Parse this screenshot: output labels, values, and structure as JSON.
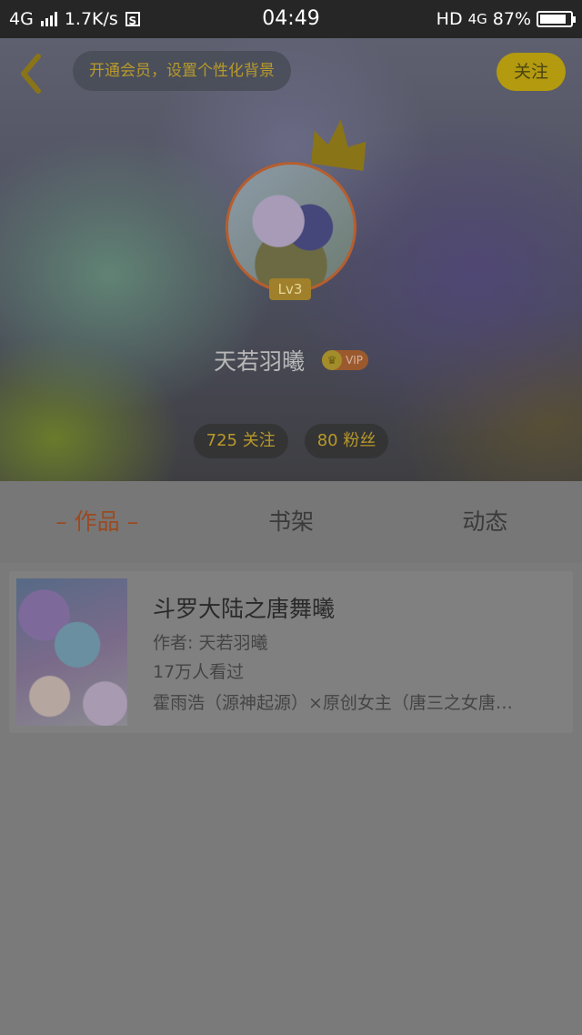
{
  "status_bar": {
    "network": "4G",
    "speed": "1.7K/s",
    "s_icon": "S",
    "time": "04:49",
    "hd": "HD",
    "network_right": "4G",
    "battery": "87%",
    "battery_level": 0.87
  },
  "header": {
    "promo": "开通会员，设置个性化背景",
    "follow": "关注",
    "level": "Lv3",
    "nickname": "天若羽曦",
    "vip": "VIP",
    "following": "725 关注",
    "fans": "80 粉丝"
  },
  "tabs": [
    {
      "label": "– 作品 –",
      "active": true
    },
    {
      "label": "书架",
      "active": false
    },
    {
      "label": "动态",
      "active": false
    }
  ],
  "works": [
    {
      "title": "斗罗大陆之唐舞曦",
      "author": "作者: 天若羽曦",
      "views": "17万人看过",
      "desc": "霍雨浩（源神起源）×原创女主（唐三之女唐…"
    }
  ],
  "colors": {
    "accent": "#b39a0f",
    "active_tab": "#9a4a22",
    "overlay_bg": "#7a7a7a"
  },
  "icons": [
    "back-arrow-icon",
    "crown-icon",
    "vip-crown-icon",
    "signal-icon",
    "battery-icon"
  ]
}
